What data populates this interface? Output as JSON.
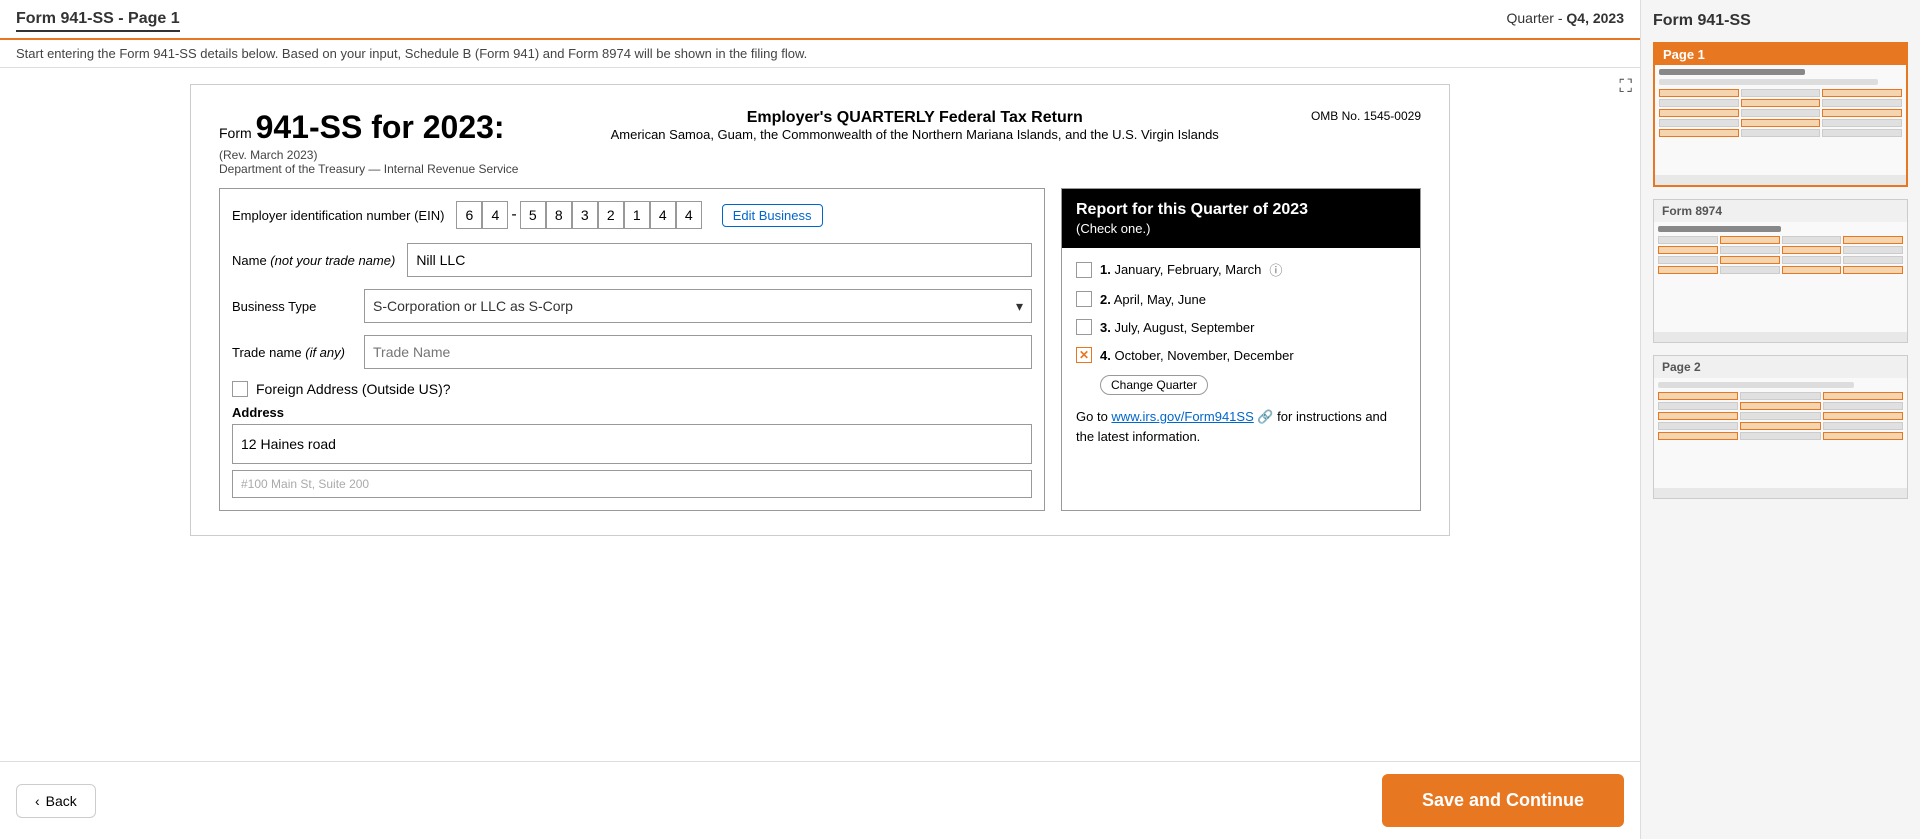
{
  "header": {
    "title": "Form 941-SS - Page 1",
    "quarter_label": "Quarter -",
    "quarter_value": "Q4, 2023"
  },
  "subtitle": "Start entering the Form 941-SS details below. Based on your input, Schedule B (Form 941) and Form 8974 will be shown in the filing flow.",
  "form": {
    "form_number": "941-SS for 2023:",
    "form_prefix": "Form",
    "rev": "(Rev. March 2023)",
    "dept": "Department of the Treasury — Internal Revenue Service",
    "main_title": "Employer's QUARTERLY Federal Tax Return",
    "sub_title": "American Samoa, Guam, the Commonwealth of the Northern Mariana Islands, and the U.S. Virgin Islands",
    "omb": "OMB No. 1545-0029",
    "ein_label": "Employer identification number (EIN)",
    "ein_digits": [
      "6",
      "4",
      "5",
      "8",
      "3",
      "2",
      "1",
      "4",
      "4"
    ],
    "edit_business_label": "Edit Business",
    "name_label": "Name (not your trade name)",
    "name_value": "Nill LLC",
    "business_type_label": "Business Type",
    "business_type_value": "S-Corporation or LLC as S-Corp",
    "trade_name_label": "Trade name (if any)",
    "trade_name_placeholder": "Trade Name",
    "foreign_address_label": "Foreign Address (Outside US)?",
    "address_label": "Address",
    "address_value": "12 Haines road",
    "address2_placeholder": "#100 Main St, Suite 200",
    "quarter_header_title": "Report for this Quarter of 2023",
    "quarter_header_sub": "(Check one.)",
    "quarter_options": [
      {
        "number": "1",
        "label": "January, February, March",
        "checked": false,
        "has_info": true
      },
      {
        "number": "2",
        "label": "April, May, June",
        "checked": false,
        "has_info": false
      },
      {
        "number": "3",
        "label": "July, August, September",
        "checked": false,
        "has_info": false
      },
      {
        "number": "4",
        "label": "October, November, December",
        "checked": true,
        "has_info": false
      }
    ],
    "change_quarter_label": "Change Quarter",
    "irs_link_text_before": "Go to ",
    "irs_link": "www.irs.gov/Form941SS",
    "irs_link_text_after": " for instructions and the latest information."
  },
  "footer": {
    "back_label": "Back",
    "save_label": "Save and Continue"
  },
  "sidebar": {
    "title": "Form 941-SS",
    "cards": [
      {
        "label": "Page 1",
        "active": true,
        "form_label": ""
      },
      {
        "label": "Form 8974",
        "active": false,
        "form_label": "Form 8974"
      },
      {
        "label": "Page 2",
        "active": false,
        "form_label": ""
      }
    ]
  }
}
